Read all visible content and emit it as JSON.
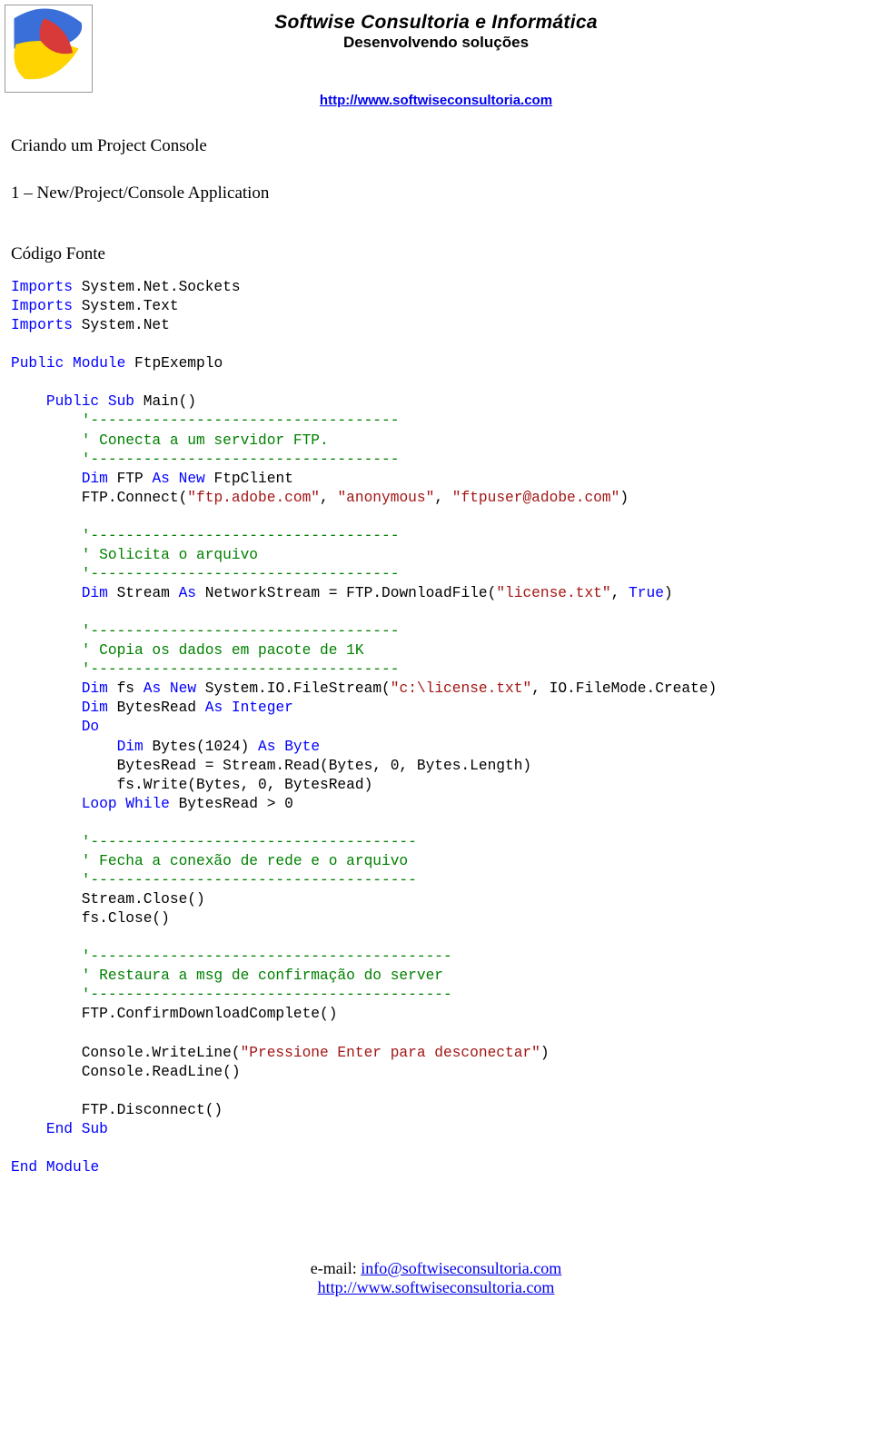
{
  "header": {
    "company": "Softwise Consultoria e Informática",
    "tagline": "Desenvolvendo soluções",
    "url": "http://www.softwiseconsultoria.com"
  },
  "body": {
    "title1": "Criando um Project Console",
    "title2": "1 – New/Project/Console Application",
    "title3": "Código Fonte"
  },
  "code": {
    "l1a": "Imports",
    "l1b": " System.Net.Sockets",
    "l2a": "Imports",
    "l2b": " System.Text",
    "l3a": "Imports",
    "l3b": " System.Net",
    "l4a": "Public",
    "l4b": " ",
    "l4c": "Module",
    "l4d": " FtpExemplo",
    "l5_indent": "    ",
    "l5a": "Public",
    "l5b": " ",
    "l5c": "Sub",
    "l5d": " Main()",
    "dash35": "'-----------------------------------",
    "c_connect": "' Conecta a um servidor FTP.",
    "l6a": "Dim",
    "l6b": " FTP ",
    "l6c": "As",
    "l6d": " ",
    "l6e": "New",
    "l6f": " FtpClient",
    "l7a": "FTP.Connect(",
    "l7b": "\"ftp.adobe.com\"",
    "l7c": ", ",
    "l7d": "\"anonymous\"",
    "l7e": ", ",
    "l7f": "\"ftpuser@adobe.com\"",
    "l7g": ")",
    "c_solicita": "' Solicita o arquivo",
    "l8a": "Dim",
    "l8b": " Stream ",
    "l8c": "As",
    "l8d": " NetworkStream = FTP.DownloadFile(",
    "l8e": "\"license.txt\"",
    "l8f": ", ",
    "l8g": "True",
    "l8h": ")",
    "c_copia": "' Copia os dados em pacote de 1K",
    "l9a": "Dim",
    "l9b": " fs ",
    "l9c": "As",
    "l9d": " ",
    "l9e": "New",
    "l9f": " System.IO.FileStream(",
    "l9g": "\"c:\\license.txt\"",
    "l9h": ", IO.FileMode.Create)",
    "l10a": "Dim",
    "l10b": " BytesRead ",
    "l10c": "As",
    "l10d": " ",
    "l10e": "Integer",
    "l11a": "Do",
    "l12a": "Dim",
    "l12b": " Bytes(1024) ",
    "l12c": "As",
    "l12d": " ",
    "l12e": "Byte",
    "l13a": "BytesRead = Stream.Read(Bytes, 0, Bytes.Length)",
    "l14a": "fs.Write(Bytes, 0, BytesRead)",
    "l15a": "Loop",
    "l15b": " ",
    "l15c": "While",
    "l15d": " BytesRead > 0",
    "dash37": "'-------------------------------------",
    "c_fecha": "' Fecha a conexão de rede e o arquivo",
    "l16a": "Stream.Close()",
    "l17a": "fs.Close()",
    "dash41": "'-----------------------------------------",
    "c_restaura": "' Restaura a msg de confirmação do server",
    "l18a": "FTP.ConfirmDownloadComplete()",
    "l19a": "Console.WriteLine(",
    "l19b": "\"Pressione Enter para desconectar\"",
    "l19c": ")",
    "l20a": "Console.ReadLine()",
    "l21a": "FTP.Disconnect()",
    "l22a": "End",
    "l22b": " ",
    "l22c": "Sub",
    "l23a": "End",
    "l23b": " ",
    "l23c": "Module"
  },
  "footer": {
    "email_label": "e-mail: ",
    "email": "info@softwiseconsultoria.com",
    "url": "http://www.softwiseconsultoria.com"
  }
}
